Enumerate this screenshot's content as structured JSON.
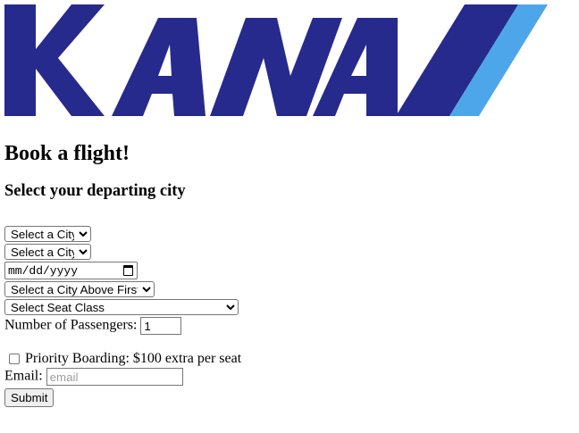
{
  "brand": {
    "logo_text": "KANA",
    "primary_color": "#262a8c",
    "accent_color": "#4ea6ea"
  },
  "heading": {
    "title": "Book a flight!",
    "subtitle": "Select your departing city"
  },
  "form": {
    "departing_city": {
      "selected": "Select a City"
    },
    "arrival_city": {
      "selected": "Select a City"
    },
    "date": {
      "placeholder": "mm/dd/yyyy"
    },
    "flight_select": {
      "selected": "Select a City Above First"
    },
    "seat_class": {
      "selected": "Select Seat Class"
    },
    "passengers": {
      "label": "Number of Passengers:",
      "value": "1"
    },
    "priority": {
      "label": "Priority Boarding: $100 extra per seat",
      "checked": false
    },
    "email": {
      "label": "Email:",
      "placeholder": "email"
    },
    "submit_label": "Submit"
  }
}
